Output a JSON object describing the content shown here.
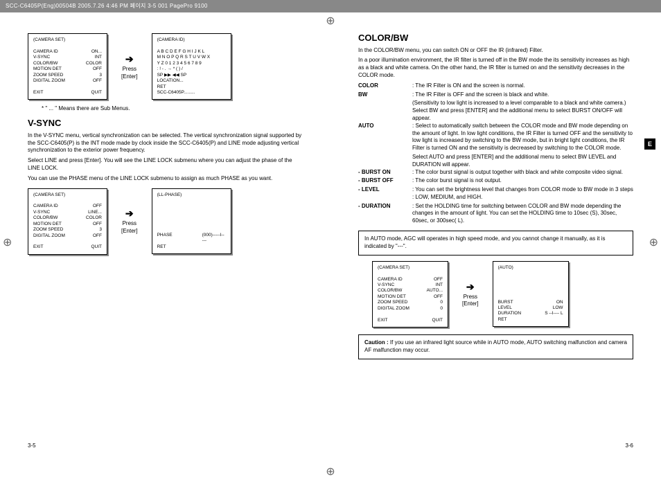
{
  "header": "SCC-C6405P(Eng)00504B   2005.7.26 4:46 PM 페이지 3-5   001 PagePro 9100",
  "side_tab": "E",
  "left": {
    "note_sub": "*  \" ... \" Means there are Sub Menus.",
    "h_vsync": "V-SYNC",
    "vsync_p1": "In the V-SYNC menu, vertical synchronization can be selected.  The vertical synchronization signal supported by the  SCC-C6405(P) is the INT mode made by clock inside the SCC-C6405(P) and LINE mode adjusting vertical synchronization to the exterior power frequency.",
    "vsync_p2": "Select LINE and press [Enter].  You will see the LINE LOCK submenu where you can adjust the phase of the LINE LOCK.",
    "vsync_p3": "You can use the PHASE menu of the LINE LOCK submenu to assign as much PHASE as you want.",
    "press_enter": "Press",
    "enter_label": "[Enter]",
    "menu1": {
      "title": "(CAMERA SET)",
      "r1a": "CAMERA ID",
      "r1b": "ON...",
      "r2a": "V-SYNC",
      "r2b": "INT",
      "r3a": "COLOR/BW",
      "r3b": "COLOR",
      "r4a": "MOTION DET",
      "r4b": "OFF",
      "r5a": "ZOOM SPEED",
      "r5b": "3",
      "r6a": "DIGITAL ZOOM",
      "r6b": "OFF",
      "r7a": "EXIT",
      "r7b": "QUIT"
    },
    "menu2": {
      "title": "(CAMERA ID)",
      "l1": "A B C D E F G H I J K L",
      "l2": "M N O P Q R S T U V W X",
      "l3": "Y Z 0 1 2 3 4 5 6 7 8 9",
      "l4": ": ! - . → * ( ) /",
      "l5": "SP ▶▶ ◀◀ SP",
      "l6": "LOCATION...",
      "l7": "RET",
      "l8": "SCC-C6405P........."
    },
    "menu3": {
      "title": "(CAMERA SET)",
      "r1a": "CAMERA ID",
      "r1b": "OFF",
      "r2a": "V-SYNC",
      "r2b": "LINE...",
      "r3a": "COLOR/BW",
      "r3b": "COLOR",
      "r4a": "MOTION DET",
      "r4b": "OFF",
      "r5a": "ZOOM SPEED",
      "r5b": "3",
      "r6a": "DIGITAL ZOOM",
      "r6b": "OFF",
      "r7a": "EXIT",
      "r7b": "QUIT"
    },
    "menu4": {
      "title": "(LL-PHASE)",
      "r1a": "PHASE",
      "r1b": "(000)-----I-----",
      "r2a": "RET",
      "r2b": ""
    },
    "page_num": "3-5"
  },
  "right": {
    "h_colorbw": "COLOR/BW",
    "intro1": "In the COLOR/BW menu, you can switch ON or OFF the IR (infrared) Filter.",
    "intro2": "In a poor illumination environment, the IR filter is turned off in the BW mode the its sensitivity increases as high as a black and white camera. On the other hand, the IR filter is turned on and the sensitivity decreases in the COLOR mode.",
    "color_l": "COLOR",
    "color_t": ": The IR Filter is ON and the screen is normal.",
    "bw_l": "BW",
    "bw_t": ": The IR Filter is OFF and the screen is black and white.",
    "bw_t2": "(Sensitivity to low light is increased to a level comparable to a black and white camera.)",
    "bw_t3": "Select BW and press [ENTER] and the additional menu to select BURST ON/OFF will appear.",
    "auto_l": "AUTO",
    "auto_t": ": Select to automatically switch between the COLOR mode and BW mode depending on the amount of light. In low light conditions, the IR Filter is turned OFF and the sensitivity to low light is increased by switching to the BW mode, but in bright light conditions, the IR Filter is turned ON and the sensitivity is decreased by switching to the COLOR mode.",
    "auto_t2": "Select AUTO and press [ENTER] and the additional menu to select BW LEVEL and DURATION will appear.",
    "burston_l": "- BURST ON",
    "burston_t": ": The color burst signal is output together with black and white composite video signal.",
    "burstoff_l": "- BURST OFF",
    "burstoff_t": ": The color burst signal is not output.",
    "level_l": "- LEVEL",
    "level_t": ": You can set the brightness level that changes from COLOR mode to BW mode in 3 steps : LOW, MEDIUM, and HIGH.",
    "dur_l": "- DURATION",
    "dur_t": ": Set the HOLDING time for switching between COLOR and BW mode depending the changes in the amount of light. You can set the HOLDING time to 10sec (S), 30sec, 60sec, or 300sec( L).",
    "note_agc": "In AUTO mode, AGC will operates in high speed mode, and you cannot change it manually, as it is indicated by \"---\".",
    "menu5": {
      "title": "(CAMERA SET)",
      "r1a": "CAMERA ID",
      "r1b": "OFF",
      "r2a": "V-SYNC",
      "r2b": "INT",
      "r3a": "COLOR/BW",
      "r3b": "AUTO...",
      "r4a": "MOTION DET",
      "r4b": "OFF",
      "r5a": "ZOOM SPEED",
      "r5b": "0",
      "r6a": "DIGITAL ZOOM",
      "r6b": "0",
      "r7a": "EXIT",
      "r7b": "QUIT"
    },
    "menu6": {
      "title": "(AUTO)",
      "r1a": "BURST",
      "r1b": "ON",
      "r2a": "LEVEL",
      "r2b": "LOW",
      "r3a": "DURATION",
      "r3b": "S --I---- L",
      "r4a": "RET",
      "r4b": ""
    },
    "caution_l": "Caution :",
    "caution_t": "If you use an infrared light source while in AUTO mode, AUTO switching malfunction and camera AF malfunction may occur.",
    "page_num": "3-6",
    "press_enter": "Press",
    "enter_label": "[Enter]"
  }
}
